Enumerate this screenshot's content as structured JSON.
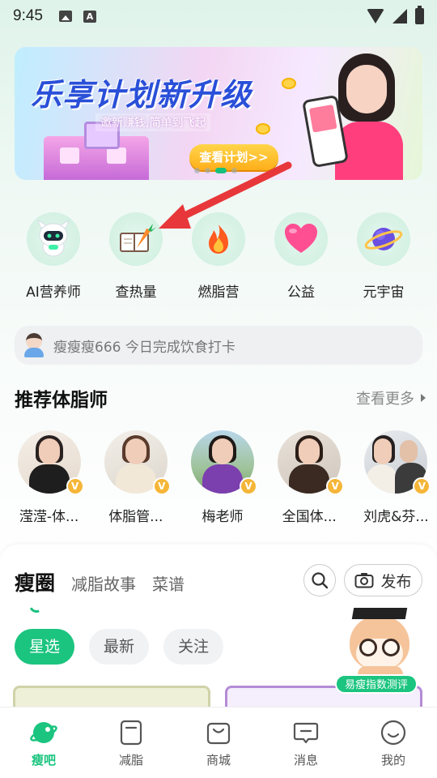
{
  "status_bar": {
    "time": "9:45"
  },
  "banner": {
    "title": "乐享计划新升级",
    "subtitle": "邀新赚钱,简单到飞起",
    "cta": "查看计划>>"
  },
  "quick_actions": [
    {
      "label": "AI营养师",
      "icon": "robot-icon"
    },
    {
      "label": "查热量",
      "icon": "book-carrot-icon"
    },
    {
      "label": "燃脂营",
      "icon": "flame-icon"
    },
    {
      "label": "公益",
      "icon": "heart-icon"
    },
    {
      "label": "元宇宙",
      "icon": "planet-icon"
    }
  ],
  "ticker": {
    "text": "瘦瘦瘦666 今日完成饮食打卡"
  },
  "recommend": {
    "title": "推荐体脂师",
    "more": "查看更多",
    "coaches": [
      {
        "name": "滢滢-体..."
      },
      {
        "name": "体脂管..."
      },
      {
        "name": "梅老师"
      },
      {
        "name": "全国体..."
      },
      {
        "name": "刘虎&芬..."
      }
    ],
    "badge": "V"
  },
  "circle": {
    "tabs": [
      "瘦圈",
      "减脂故事",
      "菜谱"
    ],
    "publish": "发布",
    "chips": [
      "星选",
      "最新",
      "关注"
    ],
    "mascot_label": "易瘦指数测评"
  },
  "bottom_nav": [
    {
      "label": "瘦吧"
    },
    {
      "label": "减脂"
    },
    {
      "label": "商城"
    },
    {
      "label": "消息"
    },
    {
      "label": "我的"
    }
  ],
  "colors": {
    "accent": "#1bc47f",
    "annotation_arrow": "#e8373a"
  }
}
